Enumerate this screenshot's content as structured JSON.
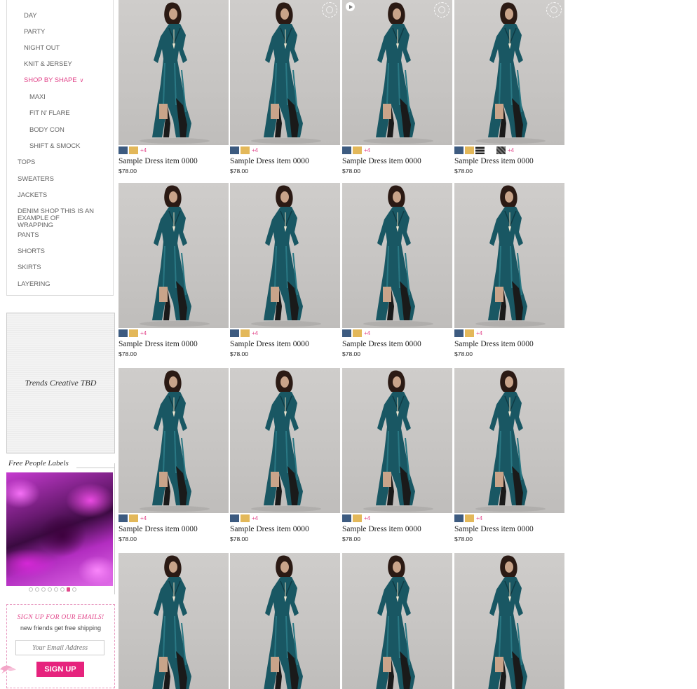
{
  "nav": {
    "items": [
      {
        "label": "Day",
        "level": 2
      },
      {
        "label": "Party",
        "level": 2
      },
      {
        "label": "Night Out",
        "level": 2
      },
      {
        "label": "Knit & Jersey",
        "level": 2
      },
      {
        "label": "Shop By Shape",
        "level": 2,
        "active": true
      },
      {
        "label": "Maxi",
        "level": 3
      },
      {
        "label": "Fit N' Flare",
        "level": 3
      },
      {
        "label": "Body Con",
        "level": 3
      },
      {
        "label": "Shift & Smock",
        "level": 3
      },
      {
        "label": "Tops",
        "level": 1
      },
      {
        "label": "Sweaters",
        "level": 1
      },
      {
        "label": "Jackets",
        "level": 1
      },
      {
        "label": "Denim Shop This is an example of wrapping",
        "level": 1
      },
      {
        "label": "Pants",
        "level": 1
      },
      {
        "label": "Shorts",
        "level": 1
      },
      {
        "label": "Skirts",
        "level": 1
      },
      {
        "label": "Layering",
        "level": 1
      }
    ],
    "active_color": "#e2478b",
    "expand_icon": "chevron-down-icon"
  },
  "trends": {
    "text": "Trends Creative TBD"
  },
  "labels": {
    "title": "Free People Labels",
    "slides": 8,
    "active_slide": 6
  },
  "signup": {
    "heading": "SIGN UP FOR OUR EMAILS!",
    "subtext": "new friends get free shipping",
    "placeholder": "Your Email Address",
    "button": "SIGN UP",
    "button_color": "#e6237d"
  },
  "products": {
    "name": "Sample Dress item 0000",
    "price": "$78.00",
    "more_colors": "+4",
    "swatch_colors": [
      "#3d5b80",
      "#e3b85a"
    ],
    "extra_swatches": [
      "striped",
      "white",
      "plaid"
    ],
    "rows": 4,
    "cols": 4,
    "badges": [
      1,
      2,
      3
    ],
    "video_card": 3
  }
}
